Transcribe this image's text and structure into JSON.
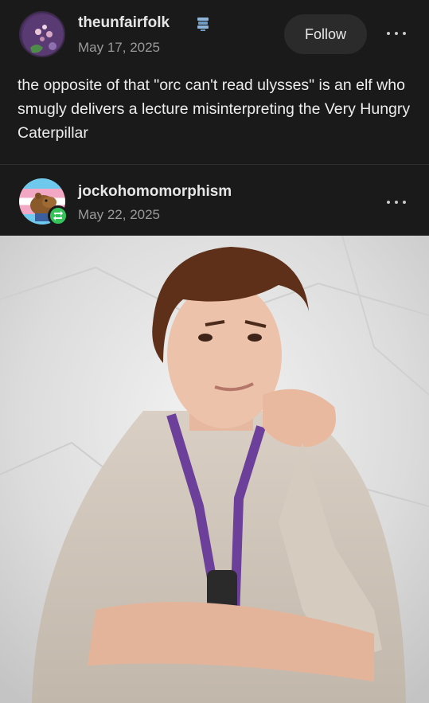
{
  "original_post": {
    "username": "theunfairfolk",
    "date": "May 17, 2025",
    "follow_label": "Follow",
    "more_icon": "more-options-icon",
    "badge_icon": "blog-badge-icon",
    "text": "the opposite of that \"orc can't read ulysses\" is an elf who smugly delivers a lecture misinterpreting the Very Hungry Caterpillar"
  },
  "reblog": {
    "username": "jockohomomorphism",
    "date": "May 22, 2025",
    "reblog_icon": "reblog-icon",
    "more_icon": "more-options-icon"
  },
  "image": {
    "subject": "photo-of-man-resting-chin-on-hand"
  },
  "colors": {
    "background": "#1a1a1a",
    "text": "#ececec",
    "muted": "#9a9a9a",
    "follow_button": "#2b2b2b",
    "reblog_green": "#36c45a"
  }
}
